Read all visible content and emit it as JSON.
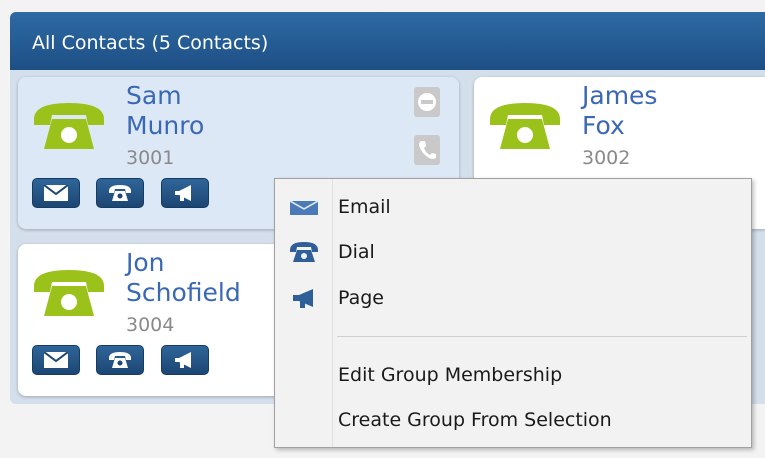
{
  "header": {
    "title": "All Contacts (5 Contacts)"
  },
  "contacts": [
    {
      "name_line1": "Sam",
      "name_line2": "Munro",
      "extension": "3001",
      "selected": true
    },
    {
      "name_line1": "James",
      "name_line2": "Fox",
      "extension": "3002",
      "selected": false
    },
    {
      "name_line1": "Jon",
      "name_line2": "Schofield",
      "extension": "3004",
      "selected": false
    }
  ],
  "context_menu": {
    "items": [
      {
        "label": "Email",
        "icon": "envelope-icon"
      },
      {
        "label": "Dial",
        "icon": "telephone-icon"
      },
      {
        "label": "Page",
        "icon": "megaphone-icon"
      }
    ],
    "group_items": [
      {
        "label": "Edit Group Membership"
      },
      {
        "label": "Create Group From Selection"
      }
    ]
  },
  "colors": {
    "header": "#1d4f85",
    "phone_green": "#9bc21b",
    "name_blue": "#3a68b5",
    "button_blue": "#1c4673"
  }
}
